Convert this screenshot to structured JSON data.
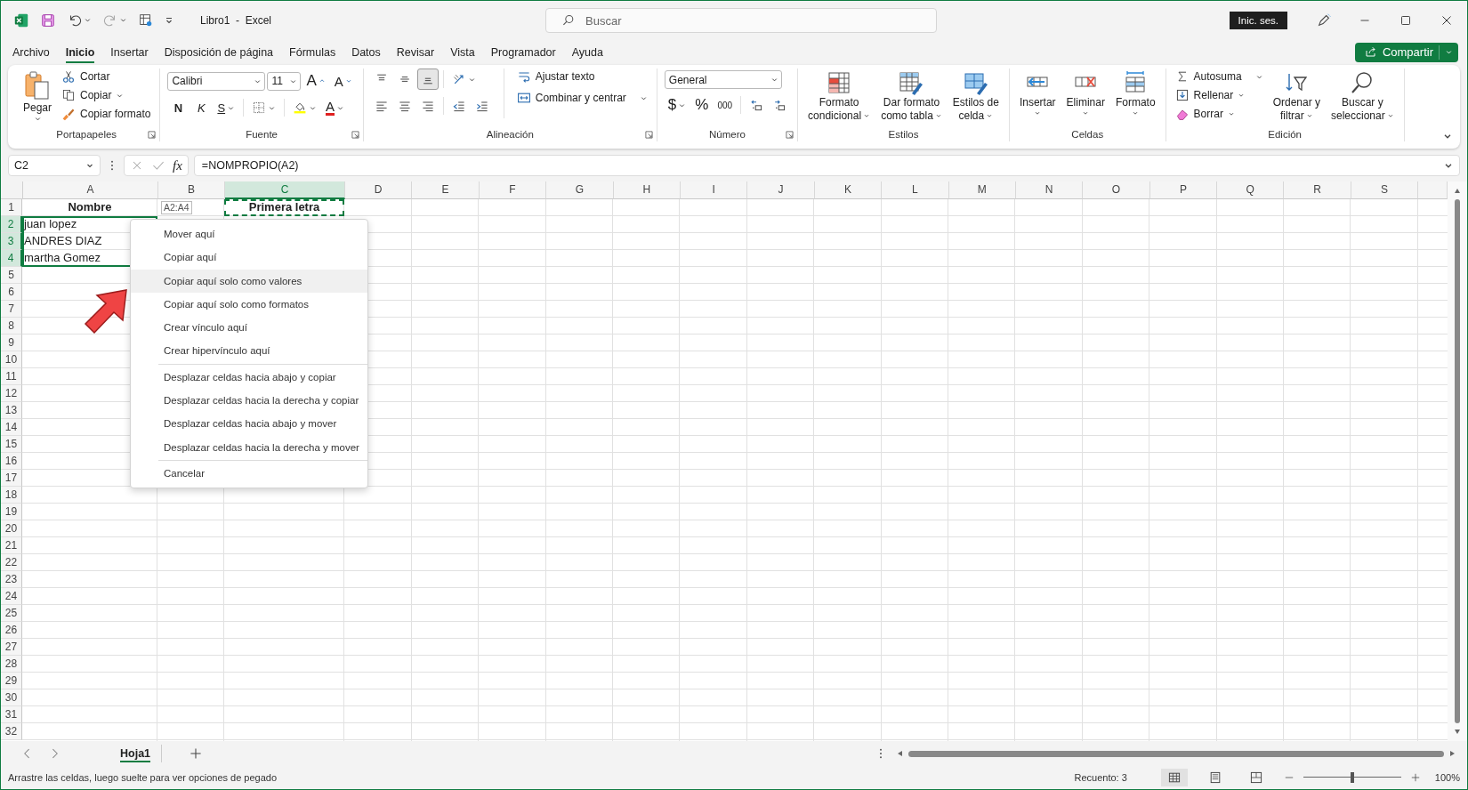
{
  "title_bar": {
    "title": "Libro1  -  Excel",
    "search": {
      "placeholder": "Buscar"
    },
    "sign_in": "Inic. ses."
  },
  "tabs": [
    {
      "label": "Archivo",
      "selected": false
    },
    {
      "label": "Inicio",
      "selected": true
    },
    {
      "label": "Insertar",
      "selected": false
    },
    {
      "label": "Disposición de página",
      "selected": false
    },
    {
      "label": "Fórmulas",
      "selected": false
    },
    {
      "label": "Datos",
      "selected": false
    },
    {
      "label": "Revisar",
      "selected": false
    },
    {
      "label": "Vista",
      "selected": false
    },
    {
      "label": "Programador",
      "selected": false
    },
    {
      "label": "Ayuda",
      "selected": false
    }
  ],
  "share_button": "Compartir",
  "ribbon": {
    "clipboard": {
      "label": "Portapapeles",
      "paste": "Pegar",
      "cut": "Cortar",
      "copy": "Copiar",
      "format_painter": "Copiar formato"
    },
    "font": {
      "label": "Fuente",
      "font_name": "Calibri",
      "font_size": "11",
      "grow": "A",
      "shrink": "A",
      "bold": "N",
      "italic": "K",
      "underline": "S",
      "font_color": "A"
    },
    "alignment": {
      "label": "Alineación",
      "vertical": [
        {
          "selected": false
        },
        {
          "selected": false
        },
        {
          "selected": true
        }
      ],
      "wrap_text": "Ajustar texto",
      "merge_center": "Combinar y centrar"
    },
    "number": {
      "label": "Número",
      "format": "General",
      "currency": "$",
      "percent": "%",
      "thousands": "000"
    },
    "styles": {
      "label": "Estilos",
      "buttons": [
        {
          "lines": [
            "Formato",
            "condicional"
          ]
        },
        {
          "lines": [
            "Dar formato",
            "como tabla"
          ]
        },
        {
          "lines": [
            "Estilos de",
            "celda"
          ]
        }
      ]
    },
    "cells": {
      "label": "Celdas",
      "buttons": [
        {
          "label": "Insertar"
        },
        {
          "label": "Eliminar"
        },
        {
          "label": "Formato"
        }
      ]
    },
    "editing": {
      "label": "Edición",
      "autosum": "Autosuma",
      "fill": "Rellenar",
      "clear": "Borrar",
      "sort_filter": [
        "Ordenar y",
        "filtrar"
      ],
      "find_select": [
        "Buscar y",
        "seleccionar"
      ]
    }
  },
  "formula_bar": {
    "name_box": "C2",
    "fx": "fx",
    "formula": "=NOMPROPIO(A2)"
  },
  "sheet": {
    "columns": [
      {
        "label": "A",
        "selected": false
      },
      {
        "label": "B",
        "selected": false
      },
      {
        "label": "C",
        "selected": true
      },
      {
        "label": "D",
        "selected": false
      },
      {
        "label": "E",
        "selected": false
      },
      {
        "label": "F",
        "selected": false
      },
      {
        "label": "G",
        "selected": false
      },
      {
        "label": "H",
        "selected": false
      },
      {
        "label": "I",
        "selected": false
      },
      {
        "label": "J",
        "selected": false
      },
      {
        "label": "K",
        "selected": false
      },
      {
        "label": "L",
        "selected": false
      },
      {
        "label": "M",
        "selected": false
      },
      {
        "label": "N",
        "selected": false
      },
      {
        "label": "O",
        "selected": false
      },
      {
        "label": "P",
        "selected": false
      },
      {
        "label": "Q",
        "selected": false
      },
      {
        "label": "R",
        "selected": false
      },
      {
        "label": "S",
        "selected": false
      }
    ],
    "rows": [
      {
        "number": "1",
        "selected": false,
        "column_a": {
          "text": "Nombre",
          "bold": true,
          "selected": false
        },
        "column_c": {
          "text": "Primera letra",
          "bold": true,
          "copy_marquee": true
        }
      },
      {
        "number": "2",
        "selected": true,
        "column_a": {
          "text": "juan lopez",
          "bold": false,
          "selected": true
        }
      },
      {
        "number": "3",
        "selected": true,
        "column_a": {
          "text": "ANDRES DIAZ",
          "bold": false,
          "selected": true
        }
      },
      {
        "number": "4",
        "selected": true,
        "column_a": {
          "text": "martha Gomez",
          "bold": false,
          "selected": true
        }
      },
      {
        "number": "5",
        "selected": false
      },
      {
        "number": "6",
        "selected": false
      },
      {
        "number": "7",
        "selected": false
      },
      {
        "number": "8",
        "selected": false
      },
      {
        "number": "9",
        "selected": false
      },
      {
        "number": "10",
        "selected": false
      },
      {
        "number": "11",
        "selected": false
      },
      {
        "number": "12",
        "selected": false
      },
      {
        "number": "13",
        "selected": false
      },
      {
        "number": "14",
        "selected": false
      },
      {
        "number": "15",
        "selected": false
      },
      {
        "number": "16",
        "selected": false
      },
      {
        "number": "17",
        "selected": false
      },
      {
        "number": "18",
        "selected": false
      },
      {
        "number": "19",
        "selected": false
      },
      {
        "number": "20",
        "selected": false
      },
      {
        "number": "21",
        "selected": false
      },
      {
        "number": "22",
        "selected": false
      },
      {
        "number": "23",
        "selected": false
      },
      {
        "number": "24",
        "selected": false
      },
      {
        "number": "25",
        "selected": false
      },
      {
        "number": "26",
        "selected": false
      },
      {
        "number": "27",
        "selected": false
      },
      {
        "number": "28",
        "selected": false
      },
      {
        "number": "29",
        "selected": false
      },
      {
        "number": "30",
        "selected": false
      },
      {
        "number": "31",
        "selected": false
      },
      {
        "number": "32",
        "selected": false
      }
    ],
    "range_tooltip": "A2:A4"
  },
  "context_menu": {
    "sections": [
      {
        "items": [
          {
            "label": "Mover aquí",
            "selected": false
          },
          {
            "label": "Copiar aquí",
            "selected": false
          },
          {
            "label": "Copiar aquí solo como valores",
            "selected": true
          },
          {
            "label": "Copiar aquí solo como formatos",
            "selected": false
          },
          {
            "label": "Crear vínculo aquí",
            "selected": false
          },
          {
            "label": "Crear hipervínculo aquí",
            "selected": false
          }
        ]
      },
      {
        "items": [
          {
            "label": "Desplazar celdas hacia abajo y copiar",
            "selected": false
          },
          {
            "label": "Desplazar celdas hacia la derecha y copiar",
            "selected": false
          },
          {
            "label": "Desplazar celdas hacia abajo y mover",
            "selected": false
          },
          {
            "label": "Desplazar celdas hacia la derecha y mover",
            "selected": false
          }
        ]
      },
      {
        "items": [
          {
            "label": "Cancelar",
            "selected": false
          }
        ]
      }
    ]
  },
  "sheet_tabs": [
    {
      "label": "Hoja1",
      "selected": true
    }
  ],
  "status_bar": {
    "message": "Arrastre las celdas, luego suelte para ver opciones de pegado",
    "count": "Recuento: 3",
    "views": [
      {
        "selected": true
      },
      {
        "selected": false
      },
      {
        "selected": false
      }
    ],
    "zoom": {
      "level": 0.5
    },
    "zoom_label": "100%"
  }
}
